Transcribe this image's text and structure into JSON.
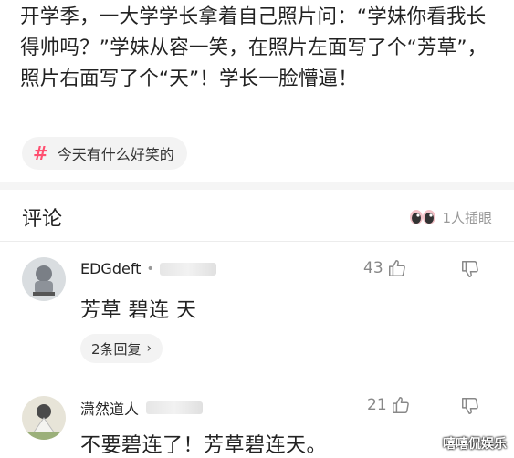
{
  "post": {
    "text": "开学季，一大学学长拿着自己照片问：“学妹你看我长得帅吗？”学妹从容一笑，在照片左面写了个“芳草”，照片右面写了个“天”！学长一脸懵逼！"
  },
  "topic": {
    "label": "今天有什么好笑的"
  },
  "comments_header": {
    "title": "评论",
    "watch_text": "1人插眼"
  },
  "comments": [
    {
      "username": "EDGdeft",
      "likes": "43",
      "text": "芳草 碧连 天",
      "replies_label": "2条回复"
    },
    {
      "username": "潇然道人",
      "likes": "21",
      "text": "不要碧连了！芳草碧连天。"
    }
  ],
  "watermark": "嘻嘻侃娱乐",
  "colors": {
    "accent": "#ff4f70",
    "muted": "#999999",
    "chip_bg": "#f3f3f3"
  }
}
